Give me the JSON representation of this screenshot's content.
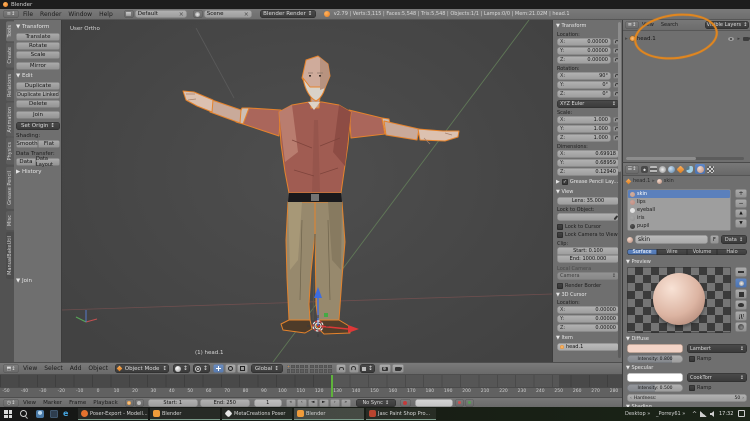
{
  "titlebar": {
    "title": "Blender"
  },
  "topbar": {
    "menus": [
      "File",
      "Render",
      "Window",
      "Help"
    ],
    "layout": "Default",
    "scene": "Scene",
    "engine": "Blender Render",
    "stats": "v2.79 | Verts:3,115 | Faces:5,548 | Tris:5,548 | Objects:1/1 | Lamps:0/0 | Mem:21.02M | head.1",
    "unlink": "×"
  },
  "tabs": [
    "Tools",
    "Create",
    "Relations",
    "Animation",
    "Physics",
    "Grease Pencil",
    "Misc",
    "ManualBakeUtil"
  ],
  "shelf": {
    "transform": "Transform",
    "translate": "Translate",
    "rotate": "Rotate",
    "scale": "Scale",
    "mirror": "Mirror",
    "edit": "Edit",
    "duplicate": "Duplicate",
    "duplicate_linked": "Duplicate Linked",
    "delete": "Delete",
    "join": "Join",
    "set_origin": "Set Origin",
    "shading": "Shading:",
    "smooth": "Smooth",
    "flat": "Flat",
    "data_transfer": "Data Transfer:",
    "data": "Data",
    "data_layout": "Data Layout",
    "history": "History",
    "operator": "Join"
  },
  "viewport": {
    "view": "User Ortho",
    "object": "(1) head.1"
  },
  "vheader": {
    "menus": [
      "View",
      "Select",
      "Add",
      "Object"
    ],
    "mode": "Object Mode",
    "orientation": "Global"
  },
  "npanel": {
    "transform": "Transform",
    "location": "Location:",
    "loc": [
      [
        "X:",
        "0.00000"
      ],
      [
        "Y:",
        "0.00000"
      ],
      [
        "Z:",
        "0.00000"
      ]
    ],
    "rotation": "Rotation:",
    "rot": [
      [
        "X:",
        "90°"
      ],
      [
        "Y:",
        "0°"
      ],
      [
        "Z:",
        "0°"
      ]
    ],
    "euler": "XYZ Euler",
    "scale": "Scale:",
    "scl": [
      [
        "X:",
        "1.000"
      ],
      [
        "Y:",
        "1.000"
      ],
      [
        "Z:",
        "1.000"
      ]
    ],
    "dimensions": "Dimensions:",
    "dim": [
      [
        "X:",
        "0.69918"
      ],
      [
        "Y:",
        "0.68959"
      ],
      [
        "Z:",
        "0.12940"
      ]
    ],
    "gpencil": "Grease Pencil Lay...",
    "view": "View",
    "lens": "Lens: 35.000",
    "lock_to_object": "Lock to Object:",
    "lock_to_cursor": "Lock to Cursor",
    "lock_camera": "Lock Camera to View",
    "clip": "Clip:",
    "clip_start": "Start: 0.100",
    "clip_end": "End: 1000.000",
    "local_camera": "Local Camera",
    "camera": "Camera",
    "render_border": "Render Border",
    "cursor": "3D Cursor",
    "cursor_location": "Location:",
    "cur": [
      [
        "X:",
        "0.00000"
      ],
      [
        "Y:",
        "0.00000"
      ],
      [
        "Z:",
        "0.00000"
      ]
    ],
    "item": "Item",
    "item_name": "head.1"
  },
  "outliner": {
    "menus": [
      "View",
      "Search"
    ],
    "display": "Visible Layers",
    "object": "head.1"
  },
  "props": {
    "object": "head.1",
    "material": "skin",
    "slots": [
      "skin",
      "lips",
      "eyeball",
      "iris",
      "pupil"
    ],
    "slot_colors": [
      "#c49a88",
      "#bf8a7e",
      "#dedede",
      "#8f8f8f",
      "#2b2b2b"
    ],
    "name": "skin",
    "fake": "F",
    "data": "Data",
    "tabs": [
      "Surface",
      "Wire",
      "Volume",
      "Halo"
    ],
    "preview": "Preview",
    "diffuse": "Diffuse",
    "diffuse_color": "#f2d3c6",
    "diffuse_model": "Lambert",
    "diffuse_intensity": "Intensity: 0.800",
    "ramp": "Ramp",
    "specular": "Specular",
    "specular_color": "#ffffff",
    "specular_model": "CookTorr",
    "specular_intensity": "Intensity: 0.500",
    "hardness": "Hardness:",
    "hardness_value": "50",
    "shading": "Shading"
  },
  "timeline": {
    "menus": [
      "View",
      "Marker",
      "Frame",
      "Playback"
    ],
    "start": "Start: 1",
    "end": "End: 250",
    "frame": "1",
    "sync": "No Sync",
    "ruler_start": -50,
    "ruler_end": 280,
    "ruler_step": 10,
    "play": [
      "«",
      "‹",
      "◄",
      "►",
      "›",
      "»"
    ]
  },
  "taskbar": {
    "apps": [
      {
        "label": "Poser-Export - Modell...",
        "icon": "firefox",
        "active": false
      },
      {
        "label": "Blender",
        "icon": "blender",
        "active": false
      },
      {
        "label": "MetaCreations Poser",
        "icon": "poser",
        "active": false
      },
      {
        "label": "Blender",
        "icon": "blender",
        "active": true
      },
      {
        "label": "Jasc Paint Shop Pro...",
        "icon": "jasc",
        "active": false
      }
    ],
    "icon_colors": {
      "firefox": "#e3712e",
      "blender": "#ef9b3a",
      "poser": "#e6e6e6",
      "jasc": "#b8452f"
    },
    "desktop": "Desktop",
    "user": "_Porrey61",
    "time": "17:32"
  }
}
